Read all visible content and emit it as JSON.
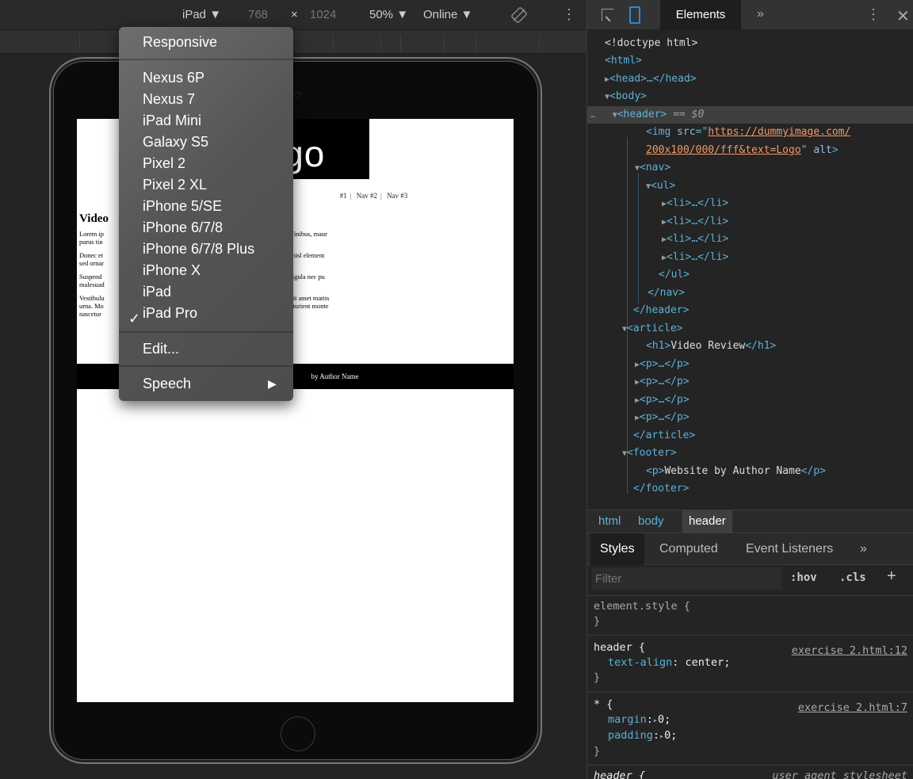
{
  "device_toolbar": {
    "device": "iPad ▼",
    "width": "768",
    "times": "×",
    "height": "1024",
    "zoom": "50% ▼",
    "network": "Online ▼"
  },
  "device_menu": {
    "responsive": "Responsive",
    "devices": [
      "Nexus 6P",
      "Nexus 7",
      "iPad Mini",
      "Galaxy S5",
      "Pixel 2",
      "Pixel 2 XL",
      "iPhone 5/SE",
      "iPhone 6/7/8",
      "iPhone 6/7/8 Plus",
      "iPhone X",
      "iPad",
      "iPad Pro"
    ],
    "selected": "iPad",
    "checkmark": "✓",
    "edit": "Edit...",
    "speech": "Speech",
    "submenu_arrow": "▶"
  },
  "page_preview": {
    "logo_text": "ogo",
    "nav": [
      "#1",
      "Nav #2",
      "Nav #3"
    ],
    "article_title": "Video",
    "paragraphs": [
      "Lorem ip                                            t. Phasellus scelerisque, sapien at tincidunt finibus, maur\npurus tin                                            lt non porttitor nisl. Morbi id nisi eros.",
      "Donec et                                            nd ut sapien. Praesent bibendum turpis non nisl element\nsed ornar",
      "Suspend                                            ue lacus vehicula congue. Vivamus congue ligula nec pu\nmalesuad",
      "Vestibulu                                            t ultrices posuere cubilia Curae; Curabitur sit amet mattis\nurna. Mo                                            i varius natoque penatibus et magnis dis parturient monte\nnascetur"
    ],
    "footer": "by Author Name"
  },
  "devtools": {
    "tab_elements": "Elements",
    "more_tabs": "»",
    "menu": "⋮",
    "close": "✕",
    "dom": {
      "doctype": "<!doctype html>",
      "img_src_1": "https://dummyimage.com/",
      "img_src_2": "200x100/000/fff&text=Logo",
      "h1_text": "Video Review",
      "footer_p": "Website by Author Name",
      "selected_marker": "== $0"
    },
    "breadcrumb": [
      "html",
      "body",
      "header"
    ],
    "styles_tabs": [
      "Styles",
      "Computed",
      "Event Listeners",
      "»"
    ],
    "filter_placeholder": "Filter",
    "hov": ":hov",
    "cls": ".cls",
    "add": "+",
    "rules": {
      "element_style": "element.style {",
      "header_selector": "header {",
      "header_source": "exercise 2.html:12",
      "text_align_prop": "text-align",
      "text_align_value": "center;",
      "star_selector": "* {",
      "star_source": "exercise 2.html:7",
      "margin_prop": "margin",
      "margin_value": "0;",
      "padding_prop": "padding",
      "padding_value": "0;",
      "ua_selector": "header {",
      "ua_source": "user agent stylesheet"
    }
  }
}
